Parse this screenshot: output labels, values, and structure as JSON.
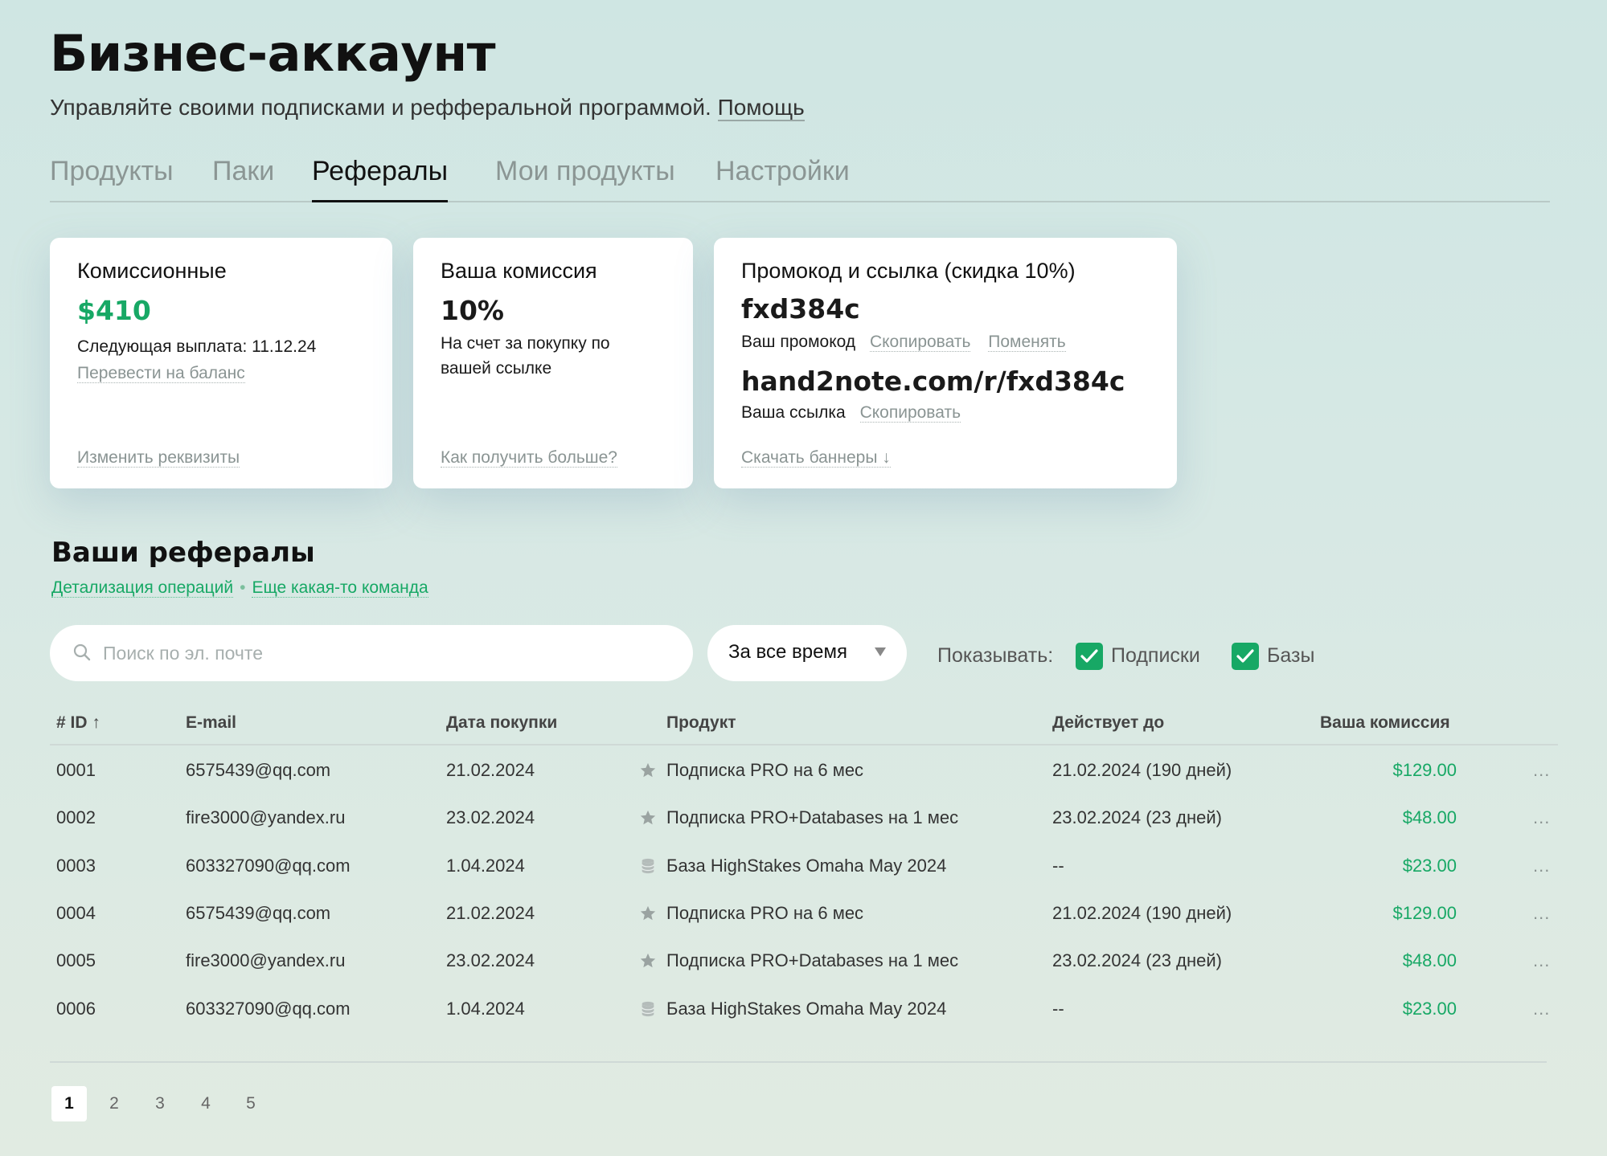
{
  "header": {
    "title": "Бизнес-аккаунт",
    "subtitle": "Управляйте своими подписками и рефферальной программой.",
    "help_link": "Помощь"
  },
  "tabs": [
    {
      "label": "Продукты",
      "active": false
    },
    {
      "label": "Паки",
      "active": false
    },
    {
      "label": "Рефералы",
      "active": true
    },
    {
      "label": "Мои продукты",
      "active": false
    },
    {
      "label": "Настройки",
      "active": false
    }
  ],
  "cards": {
    "commission": {
      "title": "Комиссионные",
      "amount": "$410",
      "next_payout": "Следующая выплата: 11.12.24",
      "transfer_link": "Перевести на баланс",
      "change_link": "Изменить реквизиты"
    },
    "rate": {
      "title": "Ваша комиссия",
      "percent": "10%",
      "description": "На счет за покупку по вашей ссылке",
      "more_link": "Как получить больше?"
    },
    "promo": {
      "title": "Промокод и ссылка (скидка 10%)",
      "code": "fxd384c",
      "code_label": "Ваш промокод",
      "copy_link": "Скопировать",
      "change_link": "Поменять",
      "url": "hand2note.com/r/fxd384c",
      "url_label": "Ваша ссылка",
      "url_copy_link": "Скопировать",
      "banners_link": "Скачать баннеры ↓"
    }
  },
  "referrals": {
    "title": "Ваши рефералы",
    "details_link": "Детализация операций",
    "other_link": "Еще какая-то команда",
    "search_placeholder": "Поиск по эл. почте",
    "period": "За все время",
    "show_label": "Показывать:",
    "filter_subscriptions": "Подписки",
    "filter_databases": "Базы",
    "columns": {
      "id": "# ID ↑",
      "email": "E-mail",
      "date": "Дата покупки",
      "product": "Продукт",
      "valid_until": "Действует до",
      "commission": "Ваша комиссия"
    },
    "rows": [
      {
        "id": "0001",
        "email": "6575439@qq.com",
        "date": "21.02.2024",
        "product_icon": "star-icon",
        "product": "Подписка PRO на 6 мес",
        "valid_until": "21.02.2024 (190 дней)",
        "commission": "$129.00",
        "more": "..."
      },
      {
        "id": "0002",
        "email": "fire3000@yandex.ru",
        "date": "23.02.2024",
        "product_icon": "star-icon",
        "product": "Подписка PRO+Databases на 1 мес",
        "valid_until": "23.02.2024 (23 дней)",
        "commission": "$48.00",
        "more": "..."
      },
      {
        "id": "0003",
        "email": "603327090@qq.com",
        "date": "1.04.2024",
        "product_icon": "database-icon",
        "product": "База HighStakes Omaha May 2024",
        "valid_until": "--",
        "commission": "$23.00",
        "more": "..."
      },
      {
        "id": "0004",
        "email": "6575439@qq.com",
        "date": "21.02.2024",
        "product_icon": "star-icon",
        "product": "Подписка PRO на 6 мес",
        "valid_until": "21.02.2024 (190 дней)",
        "commission": "$129.00",
        "more": "..."
      },
      {
        "id": "0005",
        "email": "fire3000@yandex.ru",
        "date": "23.02.2024",
        "product_icon": "star-icon",
        "product": "Подписка PRO+Databases на 1 мес",
        "valid_until": "23.02.2024 (23 дней)",
        "commission": "$48.00",
        "more": "..."
      },
      {
        "id": "0006",
        "email": "603327090@qq.com",
        "date": "1.04.2024",
        "product_icon": "database-icon",
        "product": "База HighStakes Omaha May 2024",
        "valid_until": "--",
        "commission": "$23.00",
        "more": "..."
      }
    ],
    "pages": [
      "1",
      "2",
      "3",
      "4",
      "5"
    ],
    "current_page": "1"
  },
  "colors": {
    "accent": "#17a865",
    "background_top": "#cfe6e3",
    "background_bottom": "#e1ebe2"
  }
}
